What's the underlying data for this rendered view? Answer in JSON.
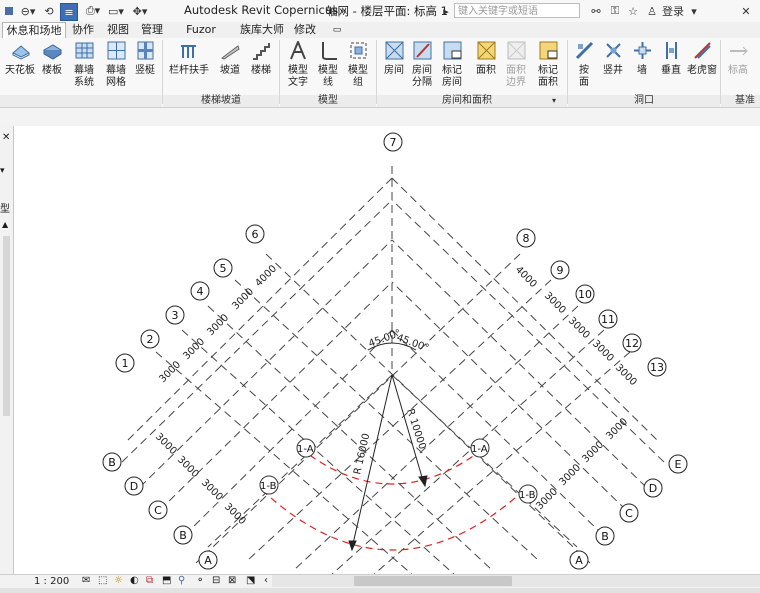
{
  "titlebar": {
    "app_title": "Autodesk Revit Copernicus -",
    "view_title": "轴网 - 楼层平面: 标高 1",
    "search_placeholder": "键入关键字或短语",
    "login_label": "登录"
  },
  "tabs": [
    "休息和场地",
    "协作",
    "视图",
    "管理",
    "Fuzor Plugin",
    "族库大师",
    "修改"
  ],
  "ribbon": {
    "buttons": [
      {
        "label": "天花板",
        "icon": "ceiling-icon"
      },
      {
        "label": "楼板",
        "icon": "floor-icon"
      },
      {
        "label": "幕墙\n系统",
        "icon": "curtain-system-icon"
      },
      {
        "label": "幕墙\n网格",
        "icon": "curtain-grid-icon"
      },
      {
        "label": "竖梃",
        "icon": "mullion-icon"
      },
      {
        "label": "栏杆扶手",
        "icon": "railing-icon"
      },
      {
        "label": "坡道",
        "icon": "ramp-icon"
      },
      {
        "label": "楼梯",
        "icon": "stair-icon"
      },
      {
        "label": "模型\n文字",
        "icon": "model-text-icon"
      },
      {
        "label": "模型\n线",
        "icon": "model-line-icon"
      },
      {
        "label": "模型\n组",
        "icon": "model-group-icon"
      },
      {
        "label": "房间",
        "icon": "room-icon"
      },
      {
        "label": "房间\n分隔",
        "icon": "room-separator-icon"
      },
      {
        "label": "标记\n房间",
        "icon": "tag-room-icon"
      },
      {
        "label": "面积",
        "icon": "area-icon"
      },
      {
        "label": "面积\n边界",
        "icon": "area-boundary-icon"
      },
      {
        "label": "标记\n面积",
        "icon": "tag-area-icon"
      },
      {
        "label": "按\n面",
        "icon": "by-face-icon"
      },
      {
        "label": "竖井",
        "icon": "shaft-icon"
      },
      {
        "label": "墙",
        "icon": "wall-opening-icon"
      },
      {
        "label": "垂直",
        "icon": "vertical-opening-icon"
      },
      {
        "label": "老虎窗",
        "icon": "dormer-icon"
      },
      {
        "label": "标高",
        "icon": "level-icon"
      }
    ],
    "panels": [
      "楼梯坡道",
      "模型",
      "房间和面积",
      "洞口",
      "基准"
    ]
  },
  "left_panel": {
    "label": "型"
  },
  "drawing": {
    "left_dims": [
      "3000",
      "3000",
      "3000",
      "3000",
      "4000"
    ],
    "right_dims": [
      "4000",
      "3000",
      "3000",
      "3000",
      "3000"
    ],
    "lower_left_dims": [
      "3000",
      "3000",
      "3000",
      "3000"
    ],
    "lower_right_dims": [
      "3000",
      "3000",
      "3000",
      "3000"
    ],
    "angle_left": "45.00°",
    "angle_right": "45.00°",
    "radius_outer": "R 16000",
    "radius_inner": "R 10000",
    "arc_labels": [
      "1-A",
      "1-B",
      "1-A",
      "1-B"
    ],
    "grid_labels_top": [
      "1",
      "2",
      "3",
      "4",
      "5",
      "6",
      "7",
      "8",
      "9",
      "10",
      "11",
      "12",
      "13"
    ],
    "grid_labels_bottom_left": [
      "B",
      "D",
      "C",
      "B",
      "A"
    ],
    "grid_labels_bottom_right": [
      "E",
      "D",
      "C",
      "B",
      "A"
    ]
  },
  "statusbar": {
    "scale": "1 : 200"
  }
}
